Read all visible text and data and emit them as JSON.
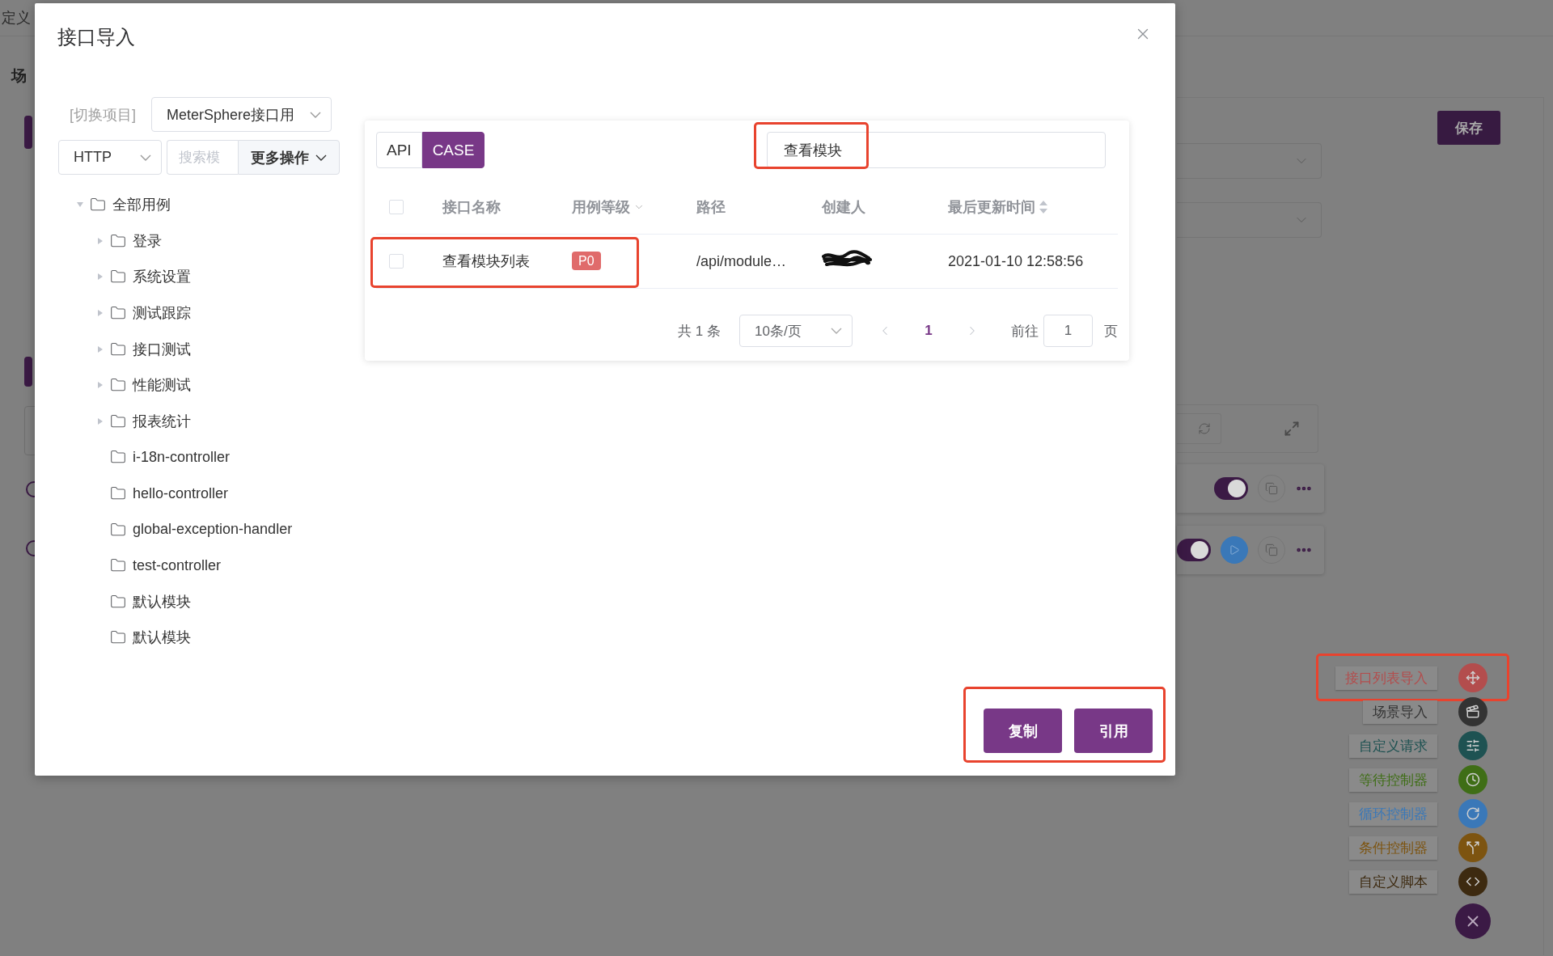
{
  "background_page": {
    "top_label": "定义",
    "section_label": "场",
    "save_button": "保存",
    "cards": [
      {
        "kind": "plain",
        "toggle_on": true
      },
      {
        "kind": "runnable",
        "toggle_on": true
      }
    ]
  },
  "add_menu": {
    "items": [
      {
        "label": "接口列表导入",
        "color": "#b34d4d"
      },
      {
        "label": "场景导入",
        "color": "#333333"
      },
      {
        "label": "自定义请求",
        "color": "#1e5252"
      },
      {
        "label": "等待控制器",
        "color": "#3f6e16"
      },
      {
        "label": "循环控制器",
        "color": "#3a78b8"
      },
      {
        "label": "条件控制器",
        "color": "#7d5410"
      },
      {
        "label": "自定义脚本",
        "color": "#3d2a10"
      }
    ]
  },
  "dialog": {
    "title": "接口导入",
    "project_label": "[切换项目]",
    "project_select": "MeterSphere接口用",
    "protocol_select": "HTTP",
    "search": {
      "placeholder": "搜索模"
    },
    "more_button": "更多操作",
    "tree": [
      {
        "label": "全部用例",
        "kind": "branch",
        "expanded": true,
        "children": [
          {
            "label": "登录",
            "kind": "branch",
            "expanded": false
          },
          {
            "label": "系统设置",
            "kind": "branch",
            "expanded": false
          },
          {
            "label": "测试跟踪",
            "kind": "branch",
            "expanded": false
          },
          {
            "label": "接口测试",
            "kind": "branch",
            "expanded": false
          },
          {
            "label": "性能测试",
            "kind": "branch",
            "expanded": false
          },
          {
            "label": "报表统计",
            "kind": "branch",
            "expanded": false
          },
          {
            "label": "i-18n-controller",
            "kind": "leaf"
          },
          {
            "label": "hello-controller",
            "kind": "leaf"
          },
          {
            "label": "global-exception-handler",
            "kind": "leaf"
          },
          {
            "label": "test-controller",
            "kind": "leaf"
          },
          {
            "label": "默认模块",
            "kind": "leaf"
          },
          {
            "label": "默认模块",
            "kind": "leaf"
          }
        ]
      }
    ],
    "tabs": [
      {
        "label": "API",
        "selected": false
      },
      {
        "label": "CASE",
        "selected": true
      }
    ],
    "case_search": {
      "value": "查看模块"
    },
    "table": {
      "select_all": {
        "checked": false
      },
      "columns": [
        {
          "label": "接口名称",
          "kind": "plain"
        },
        {
          "label": "用例等级",
          "kind": "filter"
        },
        {
          "label": "路径",
          "kind": "plain"
        },
        {
          "label": "创建人",
          "kind": "plain"
        },
        {
          "label": "最后更新时间",
          "kind": "sort"
        }
      ],
      "rows": [
        {
          "checked": false,
          "name": "查看模块列表",
          "level": "P0",
          "path": "/api/module…",
          "creator_redacted": true,
          "updated": "2021-01-10 12:58:56"
        }
      ]
    },
    "pagination": {
      "total": "共 1 条",
      "page_size": "10条/页",
      "pages": [
        {
          "label": "1",
          "selected": true
        }
      ],
      "goto_label": "前往",
      "goto_value": "1",
      "goto_suffix": "页"
    },
    "buttons": [
      "复制",
      "引用"
    ]
  }
}
